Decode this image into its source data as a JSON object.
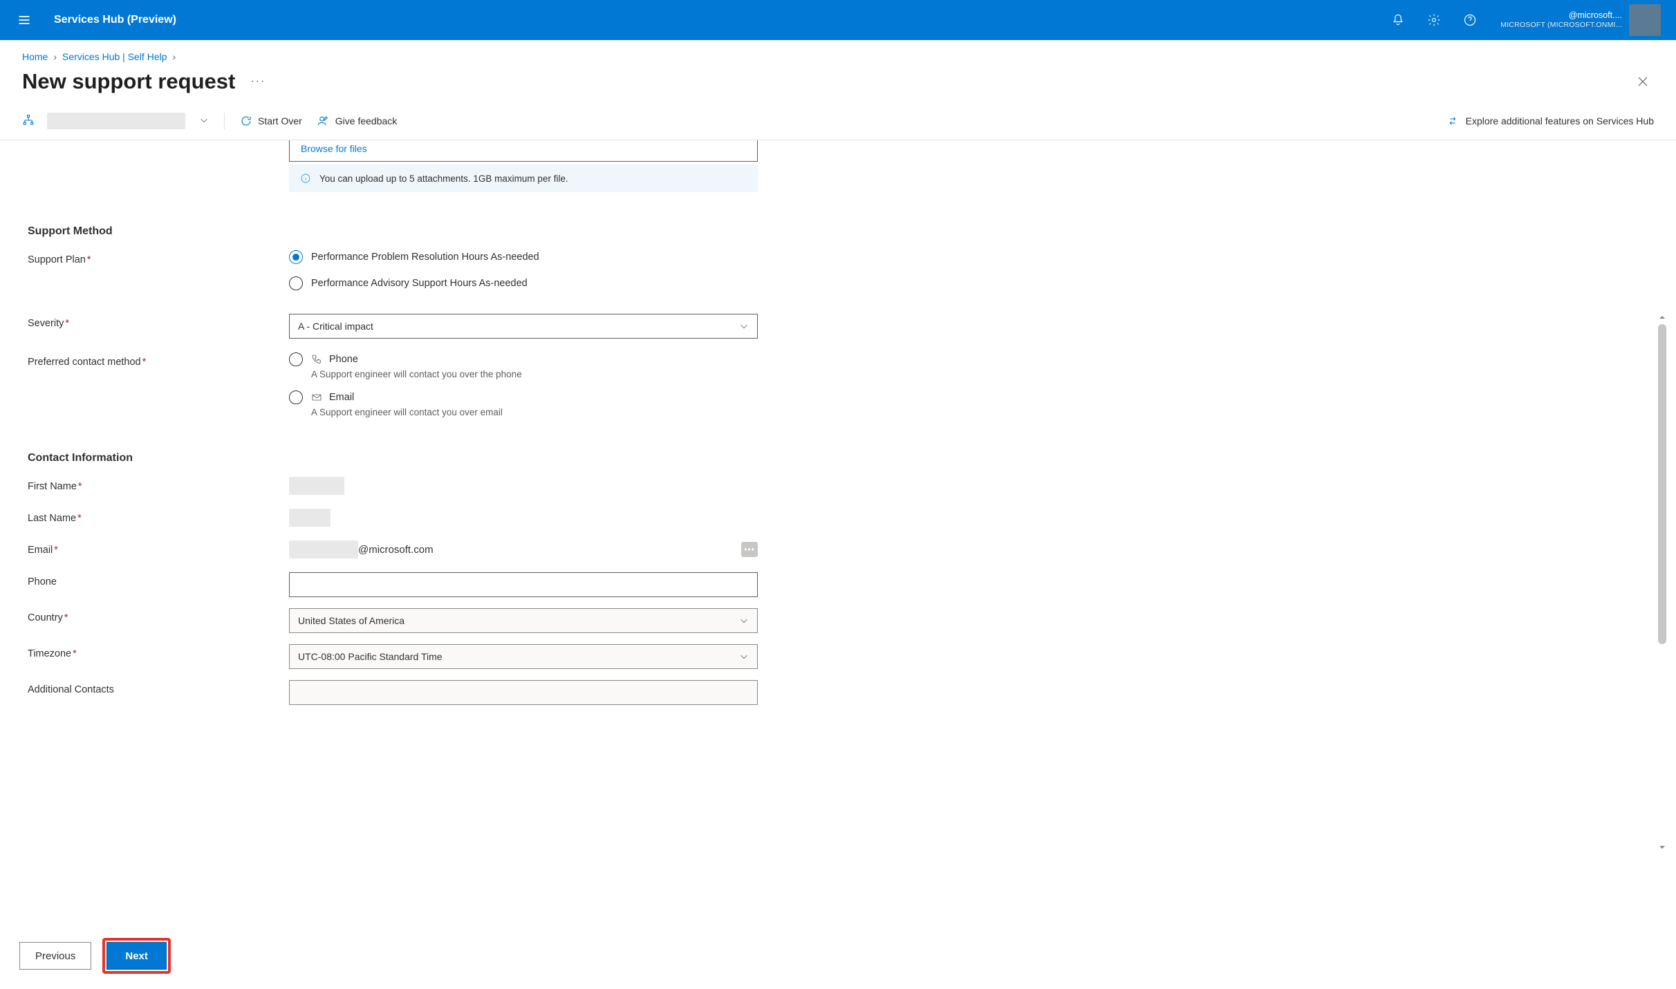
{
  "topbar": {
    "title": "Services Hub (Preview)",
    "account_line1": "@microsoft....",
    "account_line2": "MICROSOFT (MICROSOFT.ONMI..."
  },
  "breadcrumb": {
    "home": "Home",
    "self_help": "Services Hub | Self Help"
  },
  "page_title": "New support request",
  "toolbar": {
    "start_over": "Start Over",
    "give_feedback": "Give feedback",
    "explore": "Explore additional features on Services Hub"
  },
  "browse_link": "Browse for files",
  "upload_hint": "You can upload up to 5 attachments. 1GB maximum per file.",
  "sections": {
    "support_method": "Support Method",
    "contact_info": "Contact Information"
  },
  "labels": {
    "support_plan": "Support Plan",
    "severity": "Severity",
    "preferred_contact": "Preferred contact method",
    "first_name": "First Name",
    "last_name": "Last Name",
    "email": "Email",
    "phone": "Phone",
    "country": "Country",
    "timezone": "Timezone",
    "additional_contacts": "Additional Contacts"
  },
  "support_plan_options": {
    "opt1": "Performance Problem Resolution Hours As-needed",
    "opt2": "Performance Advisory Support Hours As-needed"
  },
  "severity_value": "A - Critical impact",
  "contact_methods": {
    "phone_label": "Phone",
    "phone_desc": "A Support engineer will contact you over the phone",
    "email_label": "Email",
    "email_desc": "A Support engineer will contact you over email"
  },
  "email_value_suffix": "@microsoft.com",
  "country_value": "United States of America",
  "timezone_value": "UTC-08:00 Pacific Standard Time",
  "footer": {
    "previous": "Previous",
    "next": "Next"
  }
}
